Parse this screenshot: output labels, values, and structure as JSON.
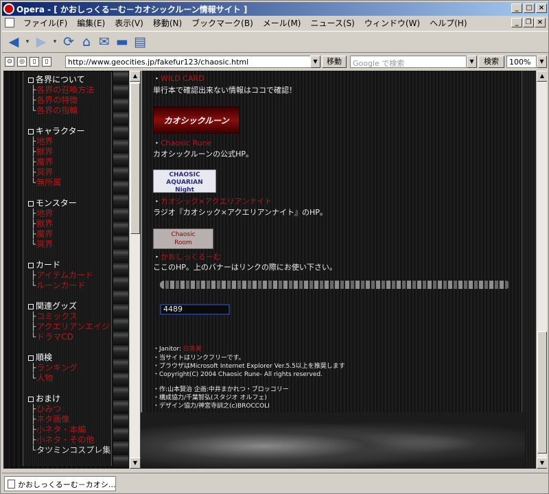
{
  "window": {
    "title": "Opera - [ かおしっくるーむ－カオシックルーン情報サイト ]"
  },
  "menu": {
    "items": [
      "ファイル(F)",
      "編集(E)",
      "表示(V)",
      "移動(N)",
      "ブックマーク(B)",
      "メール(M)",
      "ニュース(S)",
      "ウィンドウ(W)",
      "ヘルプ(H)"
    ]
  },
  "address": {
    "url": "http://www.geocities.jp/fakefur123/chaosic.html",
    "go_label": "移動",
    "search_placeholder": "Google で検索",
    "search_label": "検索",
    "zoom": "100%"
  },
  "nav": {
    "sections": [
      {
        "title": "各界について",
        "items": [
          "各界の召喚方法",
          "各界の特徴",
          "各界の指輪"
        ]
      },
      {
        "title": "キャラクター",
        "items": [
          "地界",
          "獣界",
          "魔界",
          "冥界",
          "無所属"
        ]
      },
      {
        "title": "モンスター",
        "items": [
          "地界",
          "獣界",
          "魔界",
          "冥界"
        ]
      },
      {
        "title": "カード",
        "items": [
          "アイテムカード",
          "ルーンカード"
        ]
      },
      {
        "title": "関連グッズ",
        "items": [
          "コミックス",
          "アクエリアンエイジ",
          "ドラマCD"
        ]
      },
      {
        "title": "順検",
        "items": [
          "ランキング",
          "人物"
        ]
      },
      {
        "title": "おまけ",
        "items": [
          "ひみつ",
          "ネタ画像",
          "小ネタ・本編",
          "小ネタ・その他",
          "タツミンコスプレ集"
        ]
      }
    ]
  },
  "main": {
    "link1": "WILD CARD",
    "text1": "単行本で確認出来ない情報はココで確認！",
    "banner1": "カオシックルーン",
    "link2": "Chaosic Rune",
    "text2": "カオシックルーンの公式HP。",
    "banner2_line1": "CHAOSIC",
    "banner2_line2": "AQUARIAN",
    "banner2_line3": "Night",
    "link3": "カオシック×アクエリアンナイト",
    "text3": "ラジオ『カオシック×アクエリアンナイト』のHP。",
    "banner3_line1": "Chaosic",
    "banner3_line2": "Room",
    "link4": "かおしっくるーむ",
    "text4": "ここのHP。上のバナーはリンクの際にお使い下さい。",
    "counter": "4489",
    "footer": {
      "janitor_label": "・Janitor: ",
      "janitor_name": "日香美",
      "line2": "・当サイトはリンクフリーです。",
      "line3": "・ブラウザはMicrosoft Internet Explorer Ver.5.5以上を推奨します",
      "line4": "・Copyright(C) 2004 Chaosic Rune- All rights reserved.",
      "line5": "・作:山本賢治 企画:中井まかれつ・ブロッコリー",
      "line6": "・構成協力/千葉智弘(スタジオ オルフェ)",
      "line7": "・デザイン協力/神宮寺訓之(c)BROCCOLI"
    }
  },
  "statusbar": {
    "tab": "かおしっくるーむ－カオシ…"
  },
  "colors": {
    "link_red": "#b01818",
    "titlebar": "#0a246a"
  }
}
